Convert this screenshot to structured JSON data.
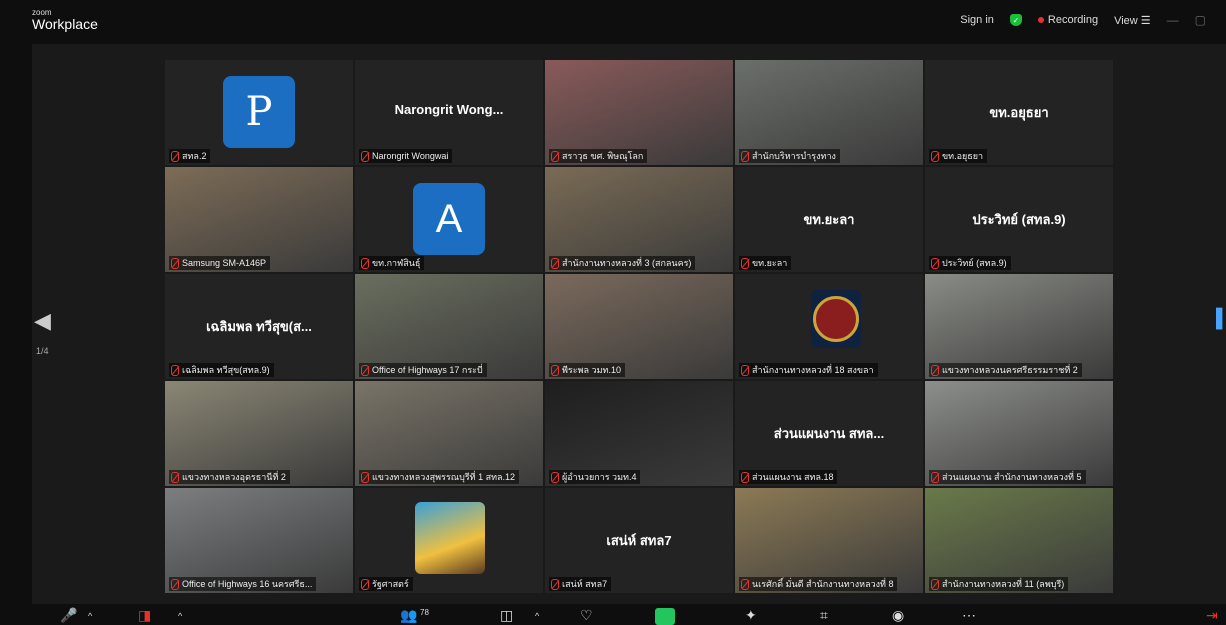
{
  "app": {
    "logo_small": "zoom",
    "logo_big": "Workplace"
  },
  "topbar": {
    "sign_in": "Sign in",
    "recording": "Recording",
    "view": "View",
    "view_icon": "grid-icon"
  },
  "pager": {
    "indicator": "1/4"
  },
  "tiles": [
    {
      "center": "",
      "avatar": "P",
      "label": "สทล.2"
    },
    {
      "center": "Narongrit  Wong...",
      "avatar": "",
      "label": "Narongrit Wongwai"
    },
    {
      "center": "",
      "avatar": "",
      "label": "สราวุธ ขศ. พิษณุโลก",
      "video": "#8a5a5a"
    },
    {
      "center": "",
      "avatar": "",
      "label": "สำนักบริหารบำรุงทาง",
      "video": "#6b6f6a",
      "active": true
    },
    {
      "center": "ขท.อยุธยา",
      "avatar": "",
      "label": "ขท.อยุธยา"
    },
    {
      "center": "",
      "avatar": "",
      "label": "Samsung SM-A146P",
      "video": "#7d6c57"
    },
    {
      "center": "",
      "avatar": "A",
      "label": "ขท.กาฬสินธุ์"
    },
    {
      "center": "",
      "avatar": "",
      "label": "สำนักงานทางหลวงที่ 3 (สกลนคร)",
      "video": "#7a6b55"
    },
    {
      "center": "ขท.ยะลา",
      "avatar": "",
      "label": "ขท.ยะลา"
    },
    {
      "center": "ประวิทย์ (สทล.9)",
      "avatar": "",
      "label": "ประวิทย์ (สทล.9)"
    },
    {
      "center": "เฉลิมพล ทวีสุข(ส...",
      "avatar": "",
      "label": "เฉลิมพล ทวีสุข(สทล.9)"
    },
    {
      "center": "",
      "avatar": "",
      "label": "Office of Highways 17 กระบี่",
      "video": "#6a6e5e"
    },
    {
      "center": "",
      "avatar": "",
      "label": "พีระพล วมท.10",
      "video": "#7b6a5c"
    },
    {
      "center": "",
      "avatar": "",
      "label": "สำนักงานทางหลวงที่ 18 สงขลา",
      "seal": true
    },
    {
      "center": "",
      "avatar": "",
      "label": "แขวงทางหลวงนครศรีธรรมราชที่ 2",
      "video": "#8a8c86"
    },
    {
      "center": "",
      "avatar": "",
      "label": "แขวงทางหลวงอุดรธานีที่ 2",
      "video": "#8b8775"
    },
    {
      "center": "",
      "avatar": "",
      "label": "แขวงทางหลวงสุพรรณบุรีที่ 1 สทล.12",
      "video": "#7a7468"
    },
    {
      "center": "",
      "avatar": "",
      "label": "ผู้อำนวยการ วมท.4",
      "video": "#1e1e1e"
    },
    {
      "center": "ส่วนแผนงาน สทล...",
      "avatar": "",
      "label": "ส่วนแผนงาน สทล.18"
    },
    {
      "center": "",
      "avatar": "",
      "label": "ส่วนแผนงาน สำนักงานทางหลวงที่ 5",
      "video": "#8d8f8c"
    },
    {
      "center": "",
      "avatar": "",
      "label": "Office of Highways 16 นครศรีธ...",
      "video": "#7c7e80"
    },
    {
      "center": "",
      "avatar": "",
      "label": "รัฐศาสตร์",
      "climb": true
    },
    {
      "center": "เสน่ห์ สทล7",
      "avatar": "",
      "label": "เสน่ห์ สทล7"
    },
    {
      "center": "",
      "avatar": "",
      "label": "นเรศักดิ์ มั่นดี สำนักงานทางหลวงที่ 8",
      "video": "#8c7a55"
    },
    {
      "center": "",
      "avatar": "",
      "label": "สำนักงานทางหลวงที่ 11 (ลพบุรี)",
      "video": "#6a7a4a"
    }
  ],
  "bottombar": {
    "participants_count": "78"
  }
}
